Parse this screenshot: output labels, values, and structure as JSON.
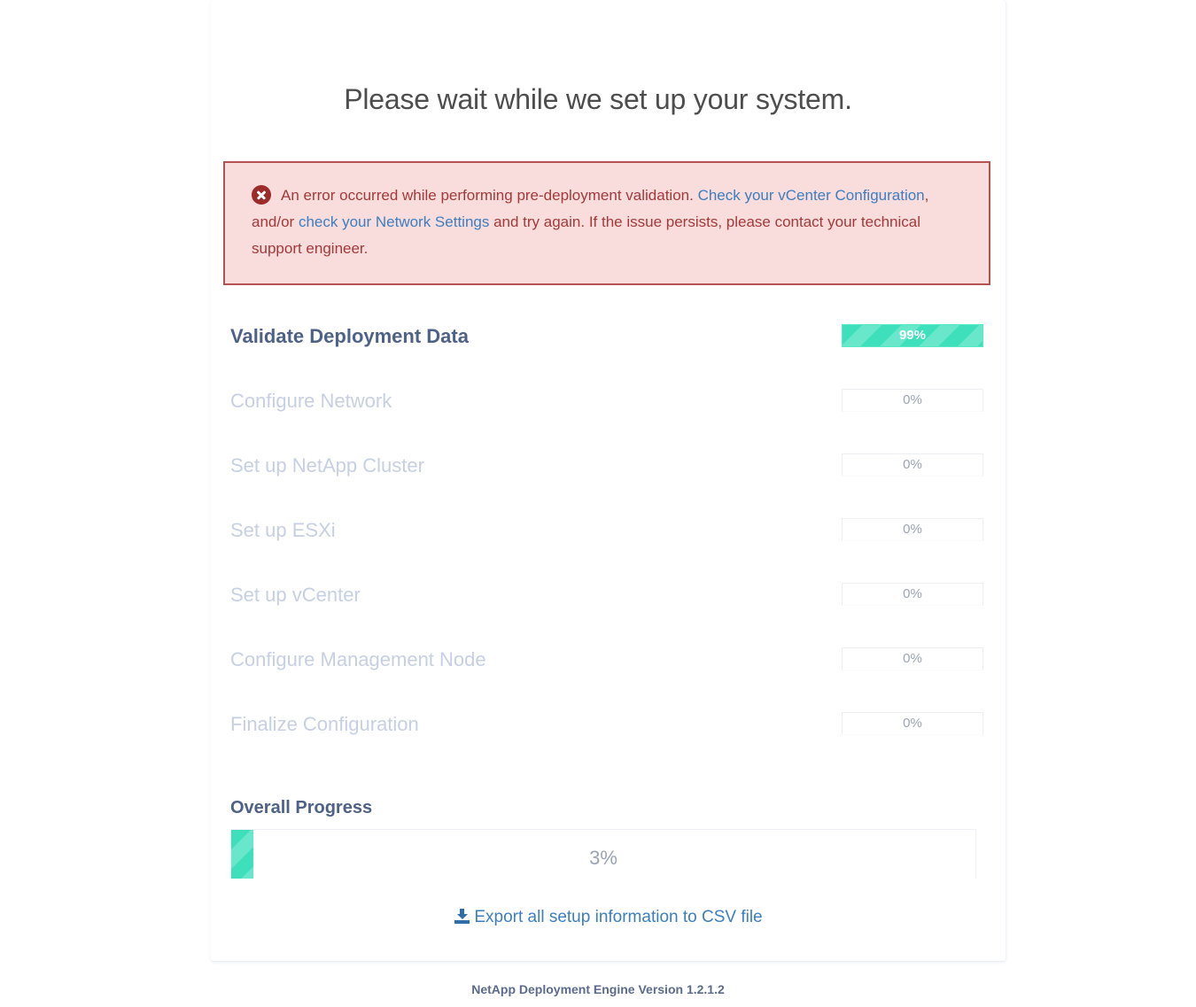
{
  "page": {
    "title": "Please wait while we set up your system.",
    "footer": "NetApp Deployment Engine Version 1.2.1.2"
  },
  "alert": {
    "icon": "error-circle-x-icon",
    "text_1": "An error occurred while performing pre-deployment validation. ",
    "link_1": "Check your vCenter Configuration",
    "text_2": ", and/or ",
    "link_2": "check your Network Settings",
    "text_3": " and try again. If the issue persists, please contact your technical support engineer.",
    "background_color": "#f9dcdc",
    "border_color": "#b45151",
    "text_color": "#a33a3a",
    "link_color": "#3c7ebf"
  },
  "steps": [
    {
      "label": "Validate Deployment Data",
      "percent": "99%",
      "value": 99,
      "state": "active"
    },
    {
      "label": "Configure Network",
      "percent": "0%",
      "value": 0,
      "state": "pending"
    },
    {
      "label": "Set up NetApp Cluster",
      "percent": "0%",
      "value": 0,
      "state": "pending"
    },
    {
      "label": "Set up ESXi",
      "percent": "0%",
      "value": 0,
      "state": "pending"
    },
    {
      "label": "Set up vCenter",
      "percent": "0%",
      "value": 0,
      "state": "pending"
    },
    {
      "label": "Configure Management Node",
      "percent": "0%",
      "value": 0,
      "state": "pending"
    },
    {
      "label": "Finalize Configuration",
      "percent": "0%",
      "value": 0,
      "state": "pending"
    }
  ],
  "overall": {
    "label": "Overall Progress",
    "percent": "3%",
    "value": 3,
    "fill_color": "#3ee0bb"
  },
  "export": {
    "icon": "download-icon",
    "label": "Export all setup information to CSV file"
  }
}
